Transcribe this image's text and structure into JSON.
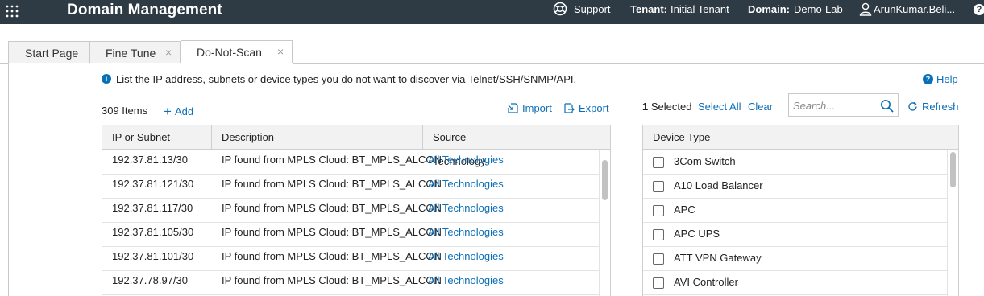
{
  "app": {
    "title": "Domain Management",
    "support_label": "Support",
    "tenant_key": "Tenant:",
    "tenant_value": "Initial Tenant",
    "domain_key": "Domain:",
    "domain_value": "Demo-Lab",
    "user_name": "ArunKumar.Beli...",
    "help_glyph": "?"
  },
  "tabs": [
    {
      "label": "Start Page",
      "closable": false,
      "active": false
    },
    {
      "label": "Fine Tune",
      "closable": true,
      "active": false
    },
    {
      "label": "Do-Not-Scan",
      "closable": true,
      "active": true
    }
  ],
  "tab_close_glyph": "×",
  "info": {
    "text": "List the IP address, subnets or device types you do not want to discover via Telnet/SSH/SNMP/API.",
    "help_label": "Help"
  },
  "toolbar": {
    "items_count": "309 Items",
    "add_label": "Add",
    "import_label": "Import",
    "export_label": "Export"
  },
  "ip_table": {
    "columns": [
      "IP or Subnet",
      "Description",
      "Source Technology"
    ],
    "rows": [
      {
        "ip": "192.37.81.13/30",
        "description": "IP found from MPLS Cloud: BT_MPLS_ALCON",
        "source": "All Technologies"
      },
      {
        "ip": "192.37.81.121/30",
        "description": "IP found from MPLS Cloud: BT_MPLS_ALCON",
        "source": "All Technologies"
      },
      {
        "ip": "192.37.81.117/30",
        "description": "IP found from MPLS Cloud: BT_MPLS_ALCON",
        "source": "All Technologies"
      },
      {
        "ip": "192.37.81.105/30",
        "description": "IP found from MPLS Cloud: BT_MPLS_ALCON",
        "source": "All Technologies"
      },
      {
        "ip": "192.37.81.101/30",
        "description": "IP found from MPLS Cloud: BT_MPLS_ALCON",
        "source": "All Technologies"
      },
      {
        "ip": "192.37.78.97/30",
        "description": "IP found from MPLS Cloud: BT_MPLS_ALCON",
        "source": "All Technologies"
      }
    ]
  },
  "device_panel": {
    "selected_count": "1",
    "selected_label": "Selected",
    "select_all_label": "Select All",
    "clear_label": "Clear",
    "search_placeholder": "Search...",
    "refresh_label": "Refresh",
    "column_header": "Device Type",
    "device_types": [
      "3Com Switch",
      "A10 Load Balancer",
      "APC",
      "APC UPS",
      "ATT VPN Gateway",
      "AVI Controller"
    ]
  },
  "colors": {
    "topbar_bg": "#2f3b44",
    "link": "#0b6fb8"
  }
}
